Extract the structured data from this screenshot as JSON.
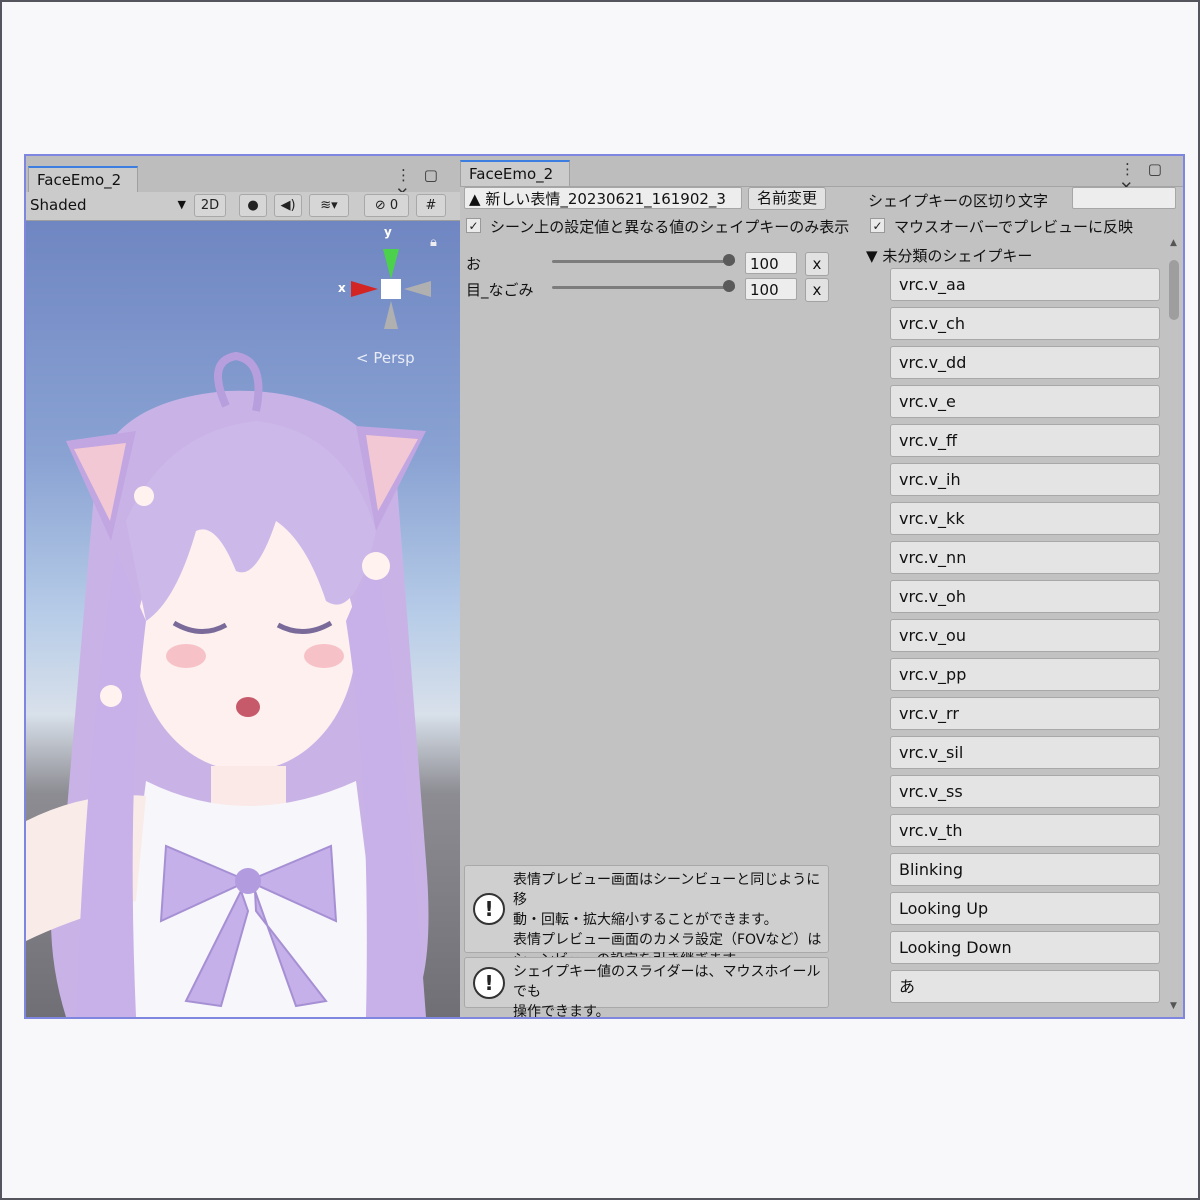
{
  "scene": {
    "tab_title": "FaceEmo_2",
    "shading_mode": "Shaded",
    "btn_2d": "2D",
    "hidden_count": "0",
    "gizmo_y": "y",
    "gizmo_x": "x",
    "projection": "Persp"
  },
  "faceemo": {
    "tab_title": "FaceEmo_2",
    "clip_name": "新しい表情_20230621_161902_3",
    "rename_button": "名前変更",
    "delimiter_label": "シェイプキーの区切り文字",
    "delimiter_value": "",
    "only_different_label": "シーン上の設定値と異なる値のシェイプキーのみ表示",
    "mouseover_label": "マウスオーバーでプレビューに反映",
    "shape_values": [
      {
        "name": "お",
        "value": "100",
        "fraction": 1.0
      },
      {
        "name": "目_なごみ",
        "value": "100",
        "fraction": 1.0
      }
    ],
    "remove_label": "x",
    "category_label": "未分類のシェイプキー",
    "shape_keys": [
      "vrc.v_aa",
      "vrc.v_ch",
      "vrc.v_dd",
      "vrc.v_e",
      "vrc.v_ff",
      "vrc.v_ih",
      "vrc.v_kk",
      "vrc.v_nn",
      "vrc.v_oh",
      "vrc.v_ou",
      "vrc.v_pp",
      "vrc.v_rr",
      "vrc.v_sil",
      "vrc.v_ss",
      "vrc.v_th",
      "Blinking",
      "Looking Up",
      "Looking Down",
      "あ"
    ],
    "help_1_line1": "表情プレビュー画面はシーンビューと同じように移",
    "help_1_line2": "動・回転・拡大縮小することができます。",
    "help_1_line3": "表情プレビュー画面のカメラ設定（FOVなど）は",
    "help_1_line4": "シーンビューの設定を引き継ぎます。",
    "help_2_line1": "シェイプキー値のスライダーは、マウスホイールでも",
    "help_2_line2": "操作できます。"
  }
}
